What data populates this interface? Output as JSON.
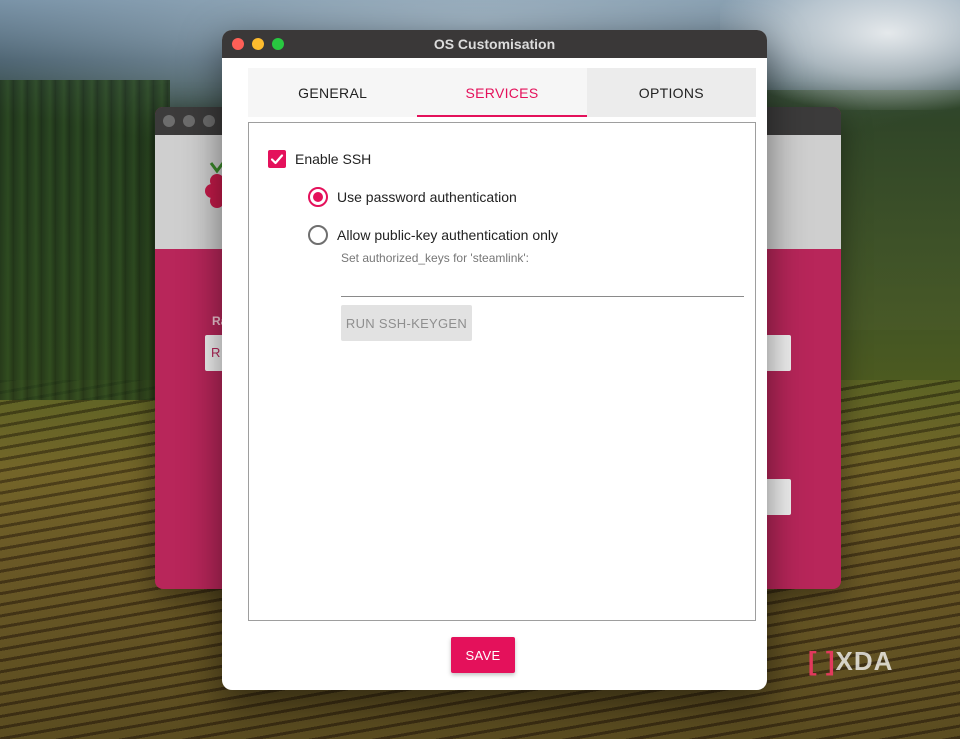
{
  "dialog": {
    "title": "OS Customisation",
    "tabs": [
      {
        "label": "GENERAL",
        "active": false
      },
      {
        "label": "SERVICES",
        "active": true
      },
      {
        "label": "OPTIONS",
        "active": false
      }
    ],
    "services": {
      "enable_ssh_label": "Enable SSH",
      "enable_ssh_checked": true,
      "auth_options": [
        {
          "label": "Use password authentication",
          "selected": true
        },
        {
          "label": "Allow public-key authentication only",
          "selected": false
        }
      ],
      "authorized_keys_hint": "Set authorized_keys for 'steamlink':",
      "authorized_keys_value": "",
      "keygen_label": "RUN SSH-KEYGEN"
    },
    "save_label": "SAVE"
  },
  "background_window": {
    "field_label_fragment": "Ra",
    "field_value_fragment": "R"
  },
  "watermark": {
    "text": "XDA"
  },
  "colors": {
    "accent": "#e4115b",
    "titlebar": "#3a3838",
    "background_window": "#b8265a"
  }
}
